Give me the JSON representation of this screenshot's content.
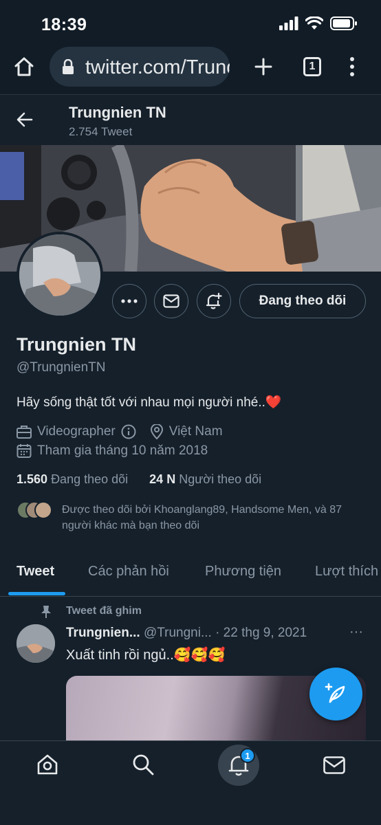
{
  "status_bar": {
    "time": "18:39"
  },
  "browser": {
    "url": "twitter.com/Trungnien",
    "tab_count": "1"
  },
  "header": {
    "name": "Trungnien TN",
    "tweet_count": "2.754 Tweet"
  },
  "profile": {
    "follow_button": "Đang theo dõi",
    "display_name": "Trungnien TN",
    "handle": "@TrungnienTN",
    "bio": "Hãy sống thật tốt với nhau mọi người nhé..",
    "bio_emoji": "❤️",
    "category": "Videographer",
    "location": "Việt Nam",
    "joined": "Tham gia tháng 10 năm 2018",
    "following_count": "1.560",
    "following_label": "Đang theo dõi",
    "followers_count": "24 N",
    "followers_label": "Người theo dõi",
    "followed_by": "Được theo dõi bởi Khoanglang89, Handsome Men, và 87 người khác mà bạn theo dõi"
  },
  "tabs": [
    {
      "label": "Tweet",
      "active": true
    },
    {
      "label": "Các phản hồi",
      "active": false
    },
    {
      "label": "Phương tiện",
      "active": false
    },
    {
      "label": "Lượt thích",
      "active": false
    }
  ],
  "pinned_tweet": {
    "pinned_label": "Tweet đã ghim",
    "author_name": "Trungnien...",
    "author_handle": "@Trungni...",
    "date": "· 22 thg 9, 2021",
    "more": "···",
    "text": "Xuất tinh rồi ngủ..🥰🥰🥰"
  },
  "bottom_nav": {
    "notification_badge": "1"
  },
  "colors": {
    "background": "#15202b",
    "accent": "#1d9bf0",
    "muted": "#8b98a5",
    "text": "#e7e9ea"
  }
}
